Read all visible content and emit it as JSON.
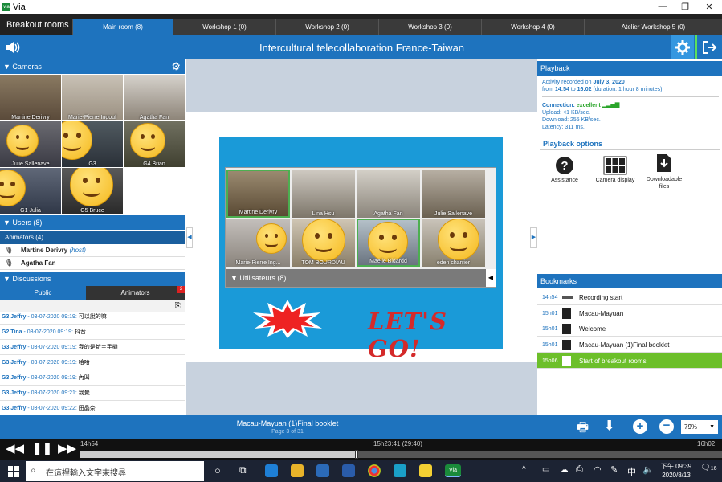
{
  "window": {
    "title": "Via",
    "logo": "via",
    "minimize": "—",
    "maximize": "❐",
    "close": "✕"
  },
  "tabs": {
    "section_label": "Breakout rooms",
    "items": [
      {
        "label": "Main room (8)"
      },
      {
        "label": "Workshop 1 (0)"
      },
      {
        "label": "Workshop 2 (0)"
      },
      {
        "label": "Workshop 3 (0)"
      },
      {
        "label": "Workshop 4 (0)"
      },
      {
        "label": "Atelier Workshop 5 (0)"
      }
    ]
  },
  "header": {
    "title": "Intercultural telecollaboration France-Taiwan"
  },
  "cameras": {
    "label": "Cameras",
    "names": [
      "Martine Derivry",
      "Marie-Pierre Ingouf",
      "Agatha Fan",
      "Julie Sallenave",
      "G3",
      "G4 Brian",
      "G1 Julia",
      "G5 Bruce"
    ]
  },
  "users": {
    "label": "Users (8)",
    "group": "Animators (4)",
    "list": [
      {
        "name": "Martine Derivry",
        "role": "(host)"
      },
      {
        "name": "Agatha Fan",
        "role": ""
      }
    ]
  },
  "discussions": {
    "label": "Discussions",
    "tab_public": "Public",
    "tab_animators": "Animators",
    "badge": "2",
    "messages": [
      {
        "user": "G3 Jeffry",
        "date": "- 03-07-2020 09:19:",
        "text": "可以說的嘛"
      },
      {
        "user": "G2 Tina",
        "date": "- 03-07-2020 09:19:",
        "text": "抖音"
      },
      {
        "user": "G3 Jeffry",
        "date": "- 03-07-2020 09:19:",
        "text": "我的是新＝手機"
      },
      {
        "user": "G3 Jeffry",
        "date": "- 03-07-2020 09:19:",
        "text": "哈哈"
      },
      {
        "user": "G3 Jeffry",
        "date": "- 03-07-2020 09:19:",
        "text": "內凹"
      },
      {
        "user": "G3 Jeffry",
        "date": "- 03-07-2020 09:21:",
        "text": "我覺"
      },
      {
        "user": "G3 Jeffry",
        "date": "- 03-07-2020 09:22:",
        "text": "田晶奈"
      }
    ]
  },
  "slide": {
    "tiles": [
      "Martine Derivry",
      "Lina Hsu",
      "Agatha Fan",
      "Julie Sallenave",
      "Marie-Pierre Ing...",
      "TOM BOURDIAU",
      "Maelle Bidardd",
      "eden charrier"
    ],
    "users_bar": "Utilisateurs (8)",
    "banner": "LET'S GO!"
  },
  "playback": {
    "label": "Playback",
    "recorded_prefix": "Activity recorded on",
    "recorded_date": "July 3, 2020",
    "from_line_a": "from",
    "from_time": "14:54",
    "to_word": "to",
    "to_time": "16:02",
    "duration": "(duration: 1 hour 8 minutes)",
    "connection_label": "Connection:",
    "connection_value": "excellent",
    "upload": "Upload: <1 KB/sec.",
    "download": "Download: 255 KB/sec.",
    "latency": "Latency: 311 ms.",
    "options_label": "Playback options",
    "options": [
      {
        "label": "Assistance",
        "icon": "question-circle-icon"
      },
      {
        "label": "Camera display",
        "icon": "camera-grid-icon"
      },
      {
        "label": "Downloadable files",
        "icon": "download-file-icon"
      }
    ]
  },
  "bookmarks": {
    "label": "Bookmarks",
    "items": [
      {
        "time": "14h54",
        "label": "Recording start"
      },
      {
        "time": "15h01",
        "label": "Macau-Mayuan"
      },
      {
        "time": "15h01",
        "label": "Welcome"
      },
      {
        "time": "15h01",
        "label": "Macau-Mayuan (1)Final booklet"
      },
      {
        "time": "15h06",
        "label": "Start of breakout rooms"
      }
    ]
  },
  "document": {
    "name": "Macau-Mayuan (1)Final booklet",
    "page": "Page 3 of 31",
    "zoom": "79%"
  },
  "player": {
    "start": "14h54",
    "current": "15h23:41 (29:40)",
    "end": "16h02",
    "progress": 0.43
  },
  "taskbar": {
    "search_placeholder": "在這裡輸入文字來搜尋",
    "time": "下午 09:39",
    "date": "2020/8/13",
    "lang": "中",
    "notif": "16"
  },
  "colors": {
    "accent": "#1e73be",
    "active_bookmark": "#6cbf2a",
    "excellent": "#2aa52a"
  }
}
